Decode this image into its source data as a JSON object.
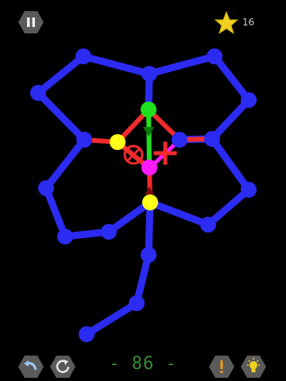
{
  "header": {
    "star_count": "16",
    "pause_icon": "pause-icon",
    "star_icon": "star-icon"
  },
  "footer": {
    "move_counter": "- 86 -",
    "undo_icon": "undo-icon",
    "restart_icon": "restart-icon",
    "hint_icon": "exclamation-icon",
    "bulb_icon": "lightbulb-icon"
  },
  "colors": {
    "blue": "#2b2bf2",
    "red": "#f22b2b",
    "green": "#1fe01f",
    "yellow": "#ffff1a",
    "magenta": "#ff1aff",
    "button_bg": "#5a5a5a",
    "star": "#f0d020"
  }
}
